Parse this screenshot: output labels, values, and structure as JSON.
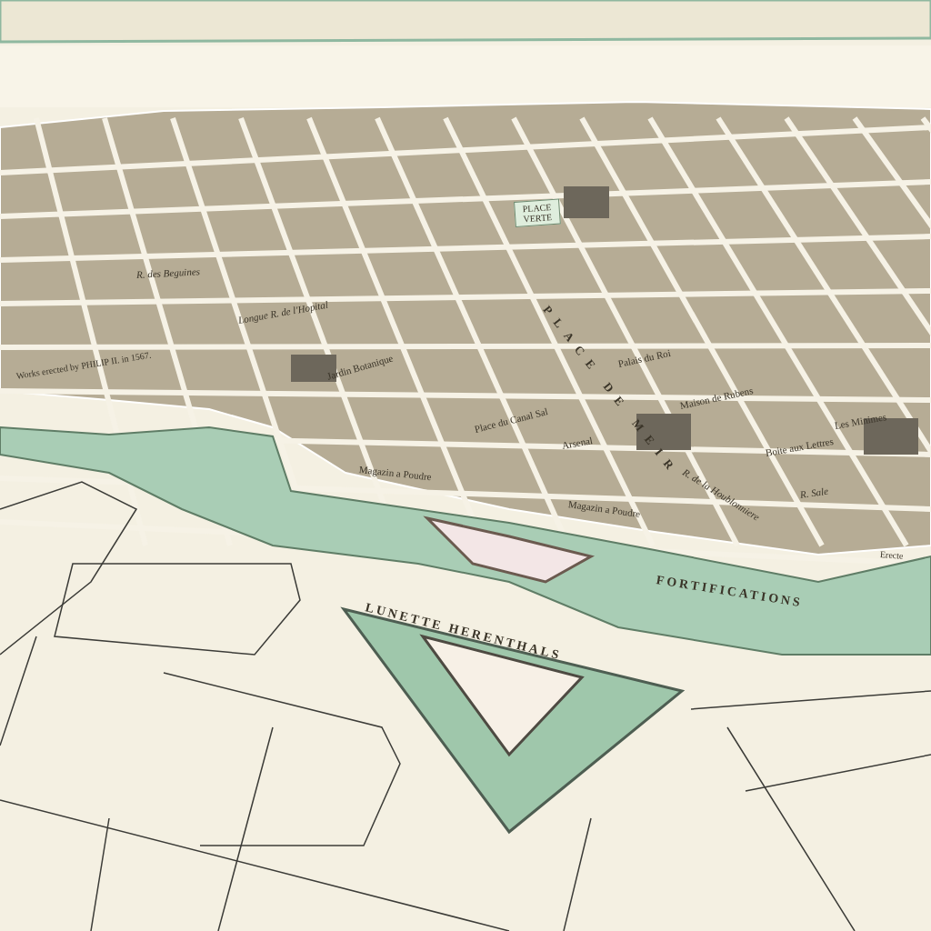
{
  "map": {
    "labels": [
      {
        "text": "PLACE VERTE",
        "kind": "square"
      },
      {
        "text": "Jardin Botanique",
        "kind": "place"
      },
      {
        "text": "Works erected by PHILIP II. in 1567.",
        "kind": "note"
      },
      {
        "text": "Place du Canal Sal",
        "kind": "place"
      },
      {
        "text": "Magazin a Poudre",
        "kind": "place"
      },
      {
        "text": "Magazin a Poudre",
        "kind": "place"
      },
      {
        "text": "FORTIFICATIONS",
        "kind": "fort"
      },
      {
        "text": "Erecte",
        "kind": "note"
      },
      {
        "text": "LUNETTE HERENTHALS",
        "kind": "fort"
      },
      {
        "text": "PLACE DE MEIR",
        "kind": "avenue"
      },
      {
        "text": "Maison de Rubens",
        "kind": "place"
      },
      {
        "text": "Boite aux Lettres",
        "kind": "place"
      },
      {
        "text": "Les Minimes",
        "kind": "place"
      },
      {
        "text": "Palais du Roi",
        "kind": "place"
      },
      {
        "text": "Longue R. de l'Hopital",
        "kind": "street"
      },
      {
        "text": "R. des Beguines",
        "kind": "street"
      },
      {
        "text": "R. Sale",
        "kind": "street"
      },
      {
        "text": "R. de la Houblonniere",
        "kind": "street"
      },
      {
        "text": "Arsenal",
        "kind": "place"
      }
    ]
  }
}
